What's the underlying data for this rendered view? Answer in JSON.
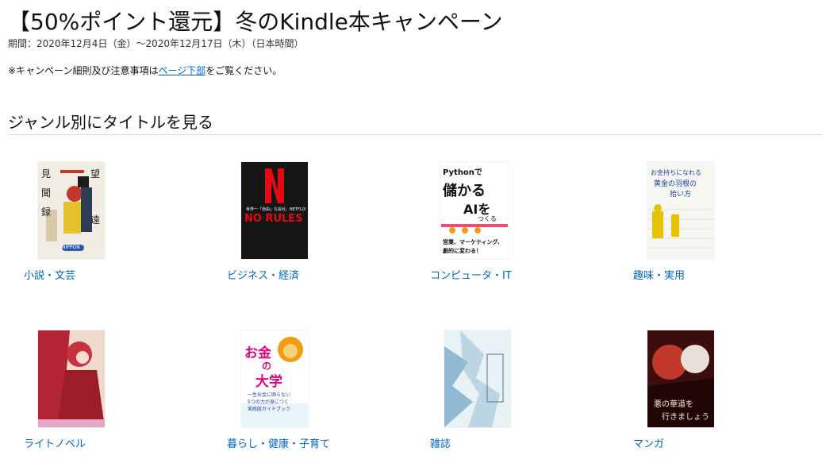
{
  "header": {
    "title": "【50%ポイント還元】冬のKindle本キャンペーン",
    "period": "期間：2020年12月4日（金）〜2020年12月17日（木）（日本時間）",
    "note_prefix": "※キャンペーン細則及び注意事項は",
    "note_link": "ページ下部",
    "note_suffix": "をご覧ください。"
  },
  "section": {
    "heading": "ジャンル別にタイトルを見る"
  },
  "genres": [
    {
      "label": "小説・文芸",
      "cover": {
        "bg": "#f2ede4",
        "texts": [
          "望",
          "見",
          "聞",
          "録",
          "遠",
          "NIPPON"
        ]
      }
    },
    {
      "label": "ビジネス・経済",
      "cover": {
        "bg": "#151515",
        "accent": "#e50914",
        "texts": [
          "N",
          "NO RULES",
          "世界一「自由」な会社、NETFLIX"
        ]
      }
    },
    {
      "label": "コンピュータ・IT",
      "cover": {
        "bg": "#ffffff",
        "texts": [
          "Pythonで",
          "儲かる",
          "AIを",
          "つくる",
          "営業、マーケティング、",
          "劇的に変わる！"
        ]
      }
    },
    {
      "label": "趣味・実用",
      "cover": {
        "bg": "#f7f7f2",
        "texts": [
          "お金持ちになれる",
          "黄金の羽根の",
          "拾い方"
        ]
      }
    },
    {
      "label": "ライトノベル",
      "cover": {
        "bg": "#8a1f2b",
        "texts": []
      }
    },
    {
      "label": "暮らし・健康・子育て",
      "cover": {
        "bg": "#ffffff",
        "texts": [
          "お金",
          "の",
          "大学",
          "一生お金に困らない",
          "5つの力が身につく",
          "実践版ガイドブック"
        ]
      }
    },
    {
      "label": "雑誌",
      "cover": {
        "bg": "#dbe9ee",
        "texts": []
      }
    },
    {
      "label": "マンガ",
      "cover": {
        "bg": "#5a1212",
        "texts": [
          "悪の華道を",
          "行きましょう"
        ]
      }
    }
  ]
}
